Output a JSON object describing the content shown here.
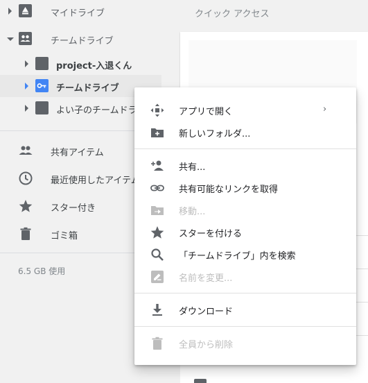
{
  "sidebar": {
    "tree": [
      {
        "label": "マイドライブ"
      },
      {
        "label": "チームドライブ"
      },
      {
        "label": "project-入退くん"
      },
      {
        "label": "チームドライブ"
      },
      {
        "label": "よい子のチームドライブ"
      }
    ],
    "nav": [
      {
        "label": "共有アイテム",
        "icon": "people-icon"
      },
      {
        "label": "最近使用したアイテム",
        "icon": "clock-icon"
      },
      {
        "label": "スター付き",
        "icon": "star-icon"
      },
      {
        "label": "ゴミ箱",
        "icon": "trash-icon"
      }
    ],
    "storage": "6.5 GB 使用"
  },
  "main": {
    "quick_access_title": "クイック アクセス"
  },
  "context_menu": {
    "items": [
      {
        "label": "アプリで開く",
        "icon": "open-with-icon",
        "has_submenu": true,
        "submenu_arrow": "›"
      },
      {
        "label": "新しいフォルダ...",
        "icon": "new-folder-icon"
      },
      {
        "label": "共有...",
        "icon": "person-add-icon"
      },
      {
        "label": "共有可能なリンクを取得",
        "icon": "link-icon"
      },
      {
        "label": "移動...",
        "icon": "move-icon",
        "disabled": true
      },
      {
        "label": "スターを付ける",
        "icon": "star-icon"
      },
      {
        "label": "「チームドライブ」内を検索",
        "icon": "search-icon"
      },
      {
        "label": "名前を変更...",
        "icon": "edit-icon",
        "disabled": true
      },
      {
        "label": "ダウンロード",
        "icon": "download-icon"
      },
      {
        "label": "全員から削除",
        "icon": "trash-icon",
        "disabled": true
      }
    ]
  },
  "colors": {
    "accent": "#4285f4",
    "icon_grey": "#5f6368",
    "disabled": "#bdbdbd",
    "background": "#f1f1f1"
  }
}
